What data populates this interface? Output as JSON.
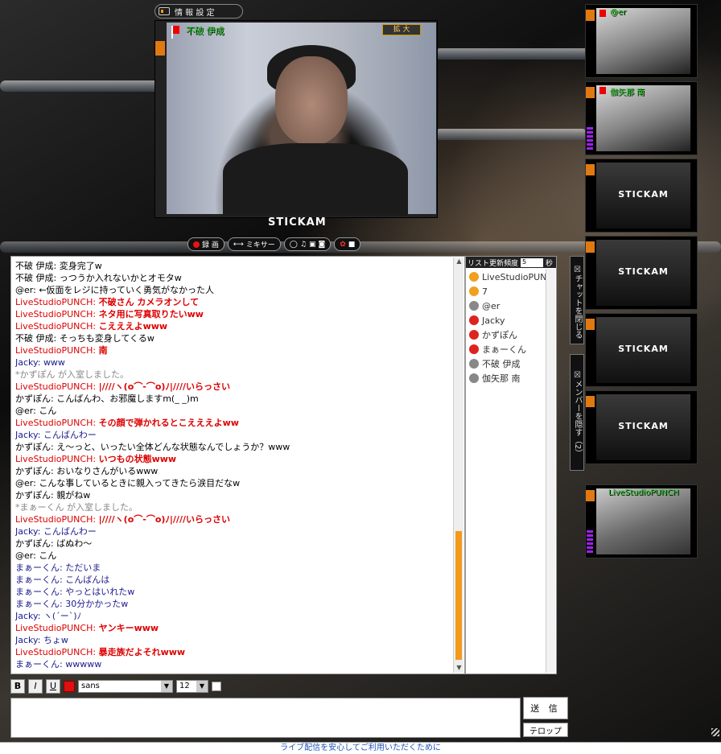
{
  "window": {
    "info_tab_label": "情 報 設 定"
  },
  "main_video": {
    "broadcaster": "不破 伊成",
    "zoom_label": "拡 大",
    "logo": "STICKAM"
  },
  "controls": {
    "record": "録 画",
    "mixer": "ミキサー"
  },
  "side_thumbs": [
    {
      "name": "@er",
      "type": "video"
    },
    {
      "name": "伽矢那 南",
      "type": "video"
    },
    {
      "label": "STICKAM",
      "type": "placeholder"
    },
    {
      "label": "STICKAM",
      "type": "placeholder"
    },
    {
      "label": "STICKAM",
      "type": "placeholder"
    },
    {
      "label": "STICKAM",
      "type": "placeholder"
    },
    {
      "name": "LiveStudioPUNCH",
      "type": "video"
    }
  ],
  "chat": {
    "lines": [
      {
        "style": "black",
        "name": "不破 伊成",
        "text": "変身完了w",
        "bold": false
      },
      {
        "style": "black",
        "name": "不破 伊成",
        "text": "っつうか入れないかとオモタw",
        "bold": false
      },
      {
        "style": "black",
        "name": "@er",
        "text": "←仮面をレジに持っていく勇気がなかった人",
        "bold": false
      },
      {
        "style": "red",
        "name": "LiveStudioPUNCH",
        "text": "不破さん カメラオンして",
        "bold": true
      },
      {
        "style": "red",
        "name": "LiveStudioPUNCH",
        "text": "ネタ用に写真取りたいww",
        "bold": true
      },
      {
        "style": "red",
        "name": "LiveStudioPUNCH",
        "text": "こえええよwww",
        "bold": true
      },
      {
        "style": "black",
        "name": "不破 伊成",
        "text": "そっちも変身してくるw",
        "bold": false
      },
      {
        "style": "red",
        "name": "LiveStudioPUNCH",
        "text": "南",
        "bold": true
      },
      {
        "style": "blue",
        "name": "Jacky",
        "text": "www",
        "bold": false
      },
      {
        "style": "gray",
        "name": "",
        "text": "*かずぽん が入室しました。",
        "bold": false
      },
      {
        "style": "red",
        "name": "LiveStudioPUNCH",
        "text": "|////ヽ(о⌒-⌒o)ﾉ|////いらっさい",
        "bold": true
      },
      {
        "style": "black",
        "name": "かずぽん",
        "text": "こんばんわ、お邪魔しますm(_ _)m",
        "bold": false
      },
      {
        "style": "black",
        "name": "@er",
        "text": "こん",
        "bold": false
      },
      {
        "style": "red",
        "name": "LiveStudioPUNCH",
        "text": "その顔で弾かれるとこえええよww",
        "bold": true
      },
      {
        "style": "blue",
        "name": "Jacky",
        "text": "こんばんわー",
        "bold": false
      },
      {
        "style": "black",
        "name": "かずぽん",
        "text": "え〜っと、いったい全体どんな状態なんでしょうか？www",
        "bold": false
      },
      {
        "style": "red",
        "name": "LiveStudioPUNCH",
        "text": "いつもの状態www",
        "bold": true
      },
      {
        "style": "black",
        "name": "かずぽん",
        "text": "おいなりさんがいるwww",
        "bold": false
      },
      {
        "style": "black",
        "name": "@er",
        "text": "こんな事しているときに親入ってきたら涙目だなw",
        "bold": false
      },
      {
        "style": "black",
        "name": "かずぽん",
        "text": "親がねw",
        "bold": false
      },
      {
        "style": "gray",
        "name": "",
        "text": "*まぁーくん が入室しました。",
        "bold": false
      },
      {
        "style": "red",
        "name": "LiveStudioPUNCH",
        "text": "|////ヽ(о⌒-⌒o)ﾉ|////いらっさい",
        "bold": true
      },
      {
        "style": "blue",
        "name": "Jacky",
        "text": "こんばんわー",
        "bold": false
      },
      {
        "style": "black",
        "name": "かずぽん",
        "text": "ばぬわ〜",
        "bold": false
      },
      {
        "style": "black",
        "name": "@er",
        "text": "こん",
        "bold": false
      },
      {
        "style": "blue",
        "name": "まぁーくん",
        "text": "ただいま",
        "bold": false
      },
      {
        "style": "blue",
        "name": "まぁーくん",
        "text": "こんばんは",
        "bold": false
      },
      {
        "style": "blue",
        "name": "まぁーくん",
        "text": "やっとはいれたw",
        "bold": false
      },
      {
        "style": "blue",
        "name": "まぁーくん",
        "text": "30分かかったw",
        "bold": false
      },
      {
        "style": "blue",
        "name": "Jacky",
        "text": "ヽ(´ー`)ﾉ",
        "bold": false
      },
      {
        "style": "red",
        "name": "LiveStudioPUNCH",
        "text": "ヤンキーwww",
        "bold": true
      },
      {
        "style": "blue",
        "name": "Jacky",
        "text": "ちょw",
        "bold": false
      },
      {
        "style": "red",
        "name": "LiveStudioPUNCH",
        "text": "暴走族だよそれwww",
        "bold": true
      },
      {
        "style": "blue",
        "name": "まぁーくん",
        "text": "wwwww",
        "bold": false
      }
    ]
  },
  "members": {
    "header_label": "リスト更新頻度",
    "refresh_value": "5",
    "unit": "秒",
    "list": [
      {
        "name": "LiveStudioPUN",
        "color": "#f0a020"
      },
      {
        "name": "7",
        "color": "#f0a020"
      },
      {
        "name": "@er",
        "color": "#888888"
      },
      {
        "name": "Jacky",
        "color": "#dd2222"
      },
      {
        "name": "かずぽん",
        "color": "#dd2222"
      },
      {
        "name": "まぁーくん",
        "color": "#dd2222"
      },
      {
        "name": "不破 伊成",
        "color": "#888888"
      },
      {
        "name": "伽矢那 南",
        "color": "#888888"
      }
    ]
  },
  "vtabs": {
    "close_chat": "チャットを閉じる",
    "hide_members": "メンバーを隠す（2）"
  },
  "format": {
    "bold": "B",
    "italic": "I",
    "underline": "U",
    "font": "sans",
    "size": "12",
    "color": "#e01010"
  },
  "input": {
    "placeholder": "",
    "send": "送 信",
    "telop": "テロップ"
  },
  "footer": {
    "text": "ライブ配信を安心してご利用いただくために"
  }
}
